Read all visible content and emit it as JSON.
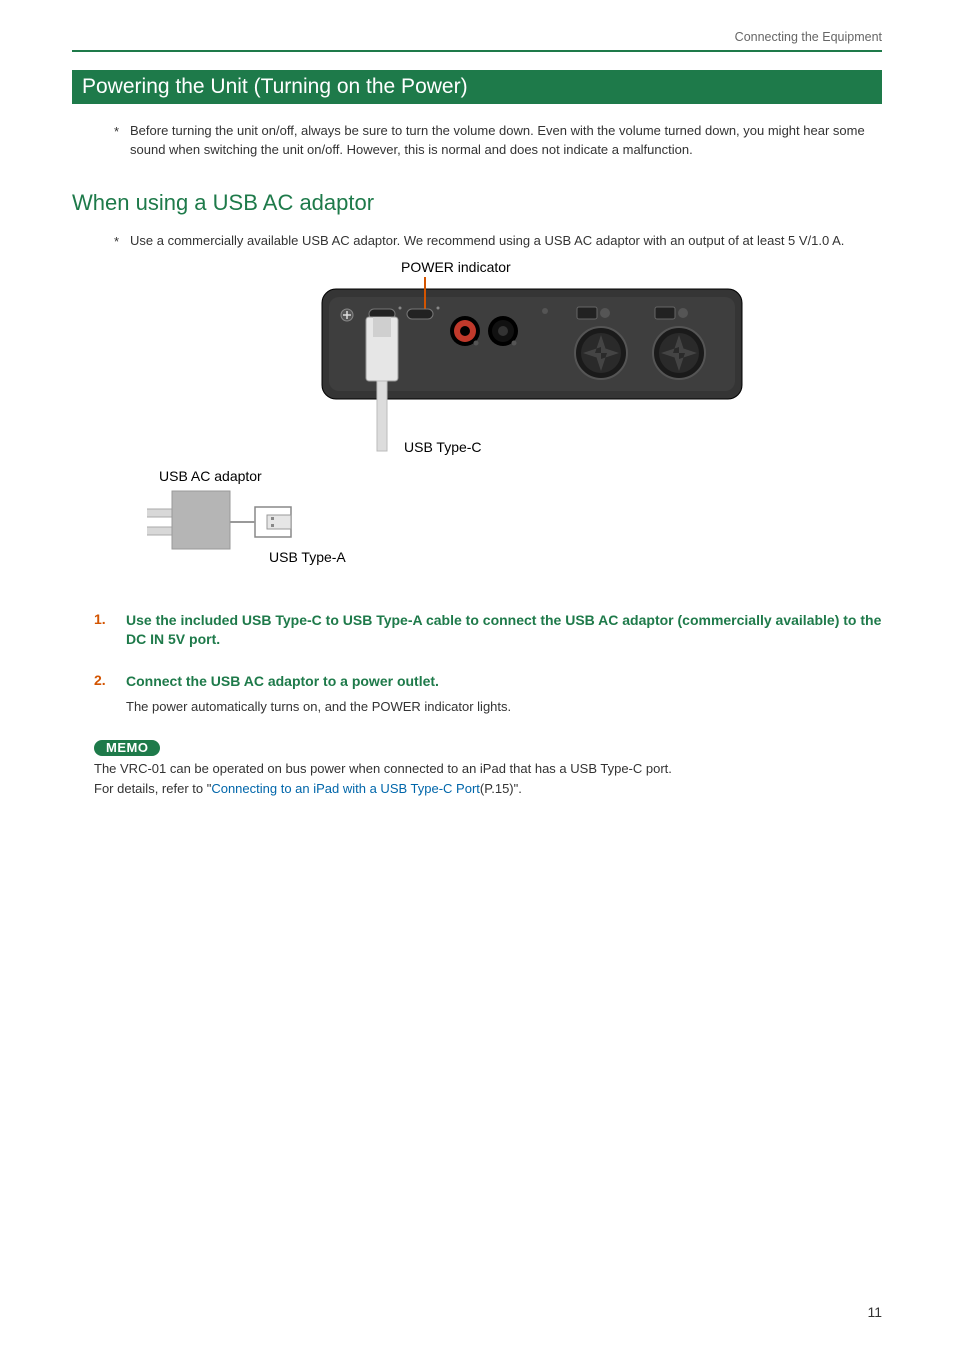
{
  "header": {
    "breadcrumb": "Connecting the Equipment"
  },
  "section": {
    "title": "Powering the Unit (Turning on the Power)"
  },
  "notes": {
    "n1": "Before turning the unit on/off, always be sure to turn the volume down. Even with the volume turned down, you might hear some sound when switching the unit on/off. However, this is normal and does not indicate a malfunction."
  },
  "subheading": "When using a USB AC adaptor",
  "subnotes": {
    "s1": "Use a commercially available USB AC adaptor. We recommend using a USB AC adaptor with an output of at least 5 V/1.0 A."
  },
  "diagram": {
    "label_power": "POWER indicator",
    "label_usb_c": "USB Type-C",
    "label_adaptor": "USB AC adaptor",
    "label_usb_a": "USB Type-A"
  },
  "steps": {
    "s1": {
      "num": "1.",
      "text": "Use the included USB Type-C to USB Type-A cable to connect the USB AC adaptor (commercially available) to the DC IN 5V port."
    },
    "s2": {
      "num": "2.",
      "text": "Connect the USB AC adaptor to a power outlet.",
      "sub": "The power automatically turns on, and the POWER indicator lights."
    }
  },
  "memo": {
    "badge": "MEMO",
    "line1_pre": "The VRC-01 can be operated on bus power when connected to an iPad that has a USB Type-C port.",
    "line2_pre": "For details, refer to \"",
    "link": "Connecting to an iPad with a USB Type-C Port",
    "line2_post": "(P.15)\"."
  },
  "page": "11"
}
